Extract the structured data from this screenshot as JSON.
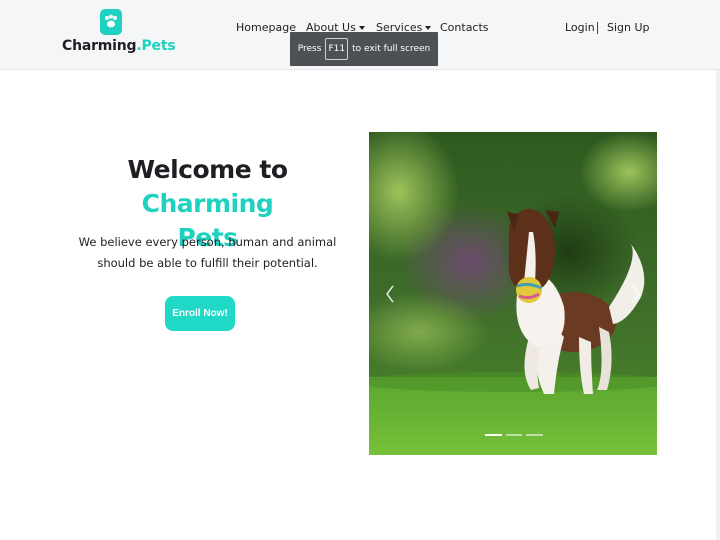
{
  "brand": {
    "name_main": "Charming",
    "name_accent": ".Pets",
    "accent_color": "#1fd1c0",
    "logo_icon": "paw-icon"
  },
  "nav": {
    "homepage": "Homepage",
    "about": "About Us",
    "services": "Services",
    "contacts": "Contacts",
    "login": "Login",
    "signup": "Sign Up"
  },
  "toast": {
    "press": "Press",
    "key": "F11",
    "rest": "to exit full screen"
  },
  "hero": {
    "title_main": "Welcome to ",
    "title_accent_1": "Charming",
    "title_accent_2": "Pets",
    "subtitle": "We believe every person, human and animal should be able to fulfill their potential.",
    "cta": "Enroll Now!"
  },
  "carousel": {
    "image_alt": "border-collie-running-with-ball",
    "prev_icon": "chevron-left-icon",
    "next_icon": "chevron-right-icon",
    "slides": 3,
    "active_slide": 1
  }
}
